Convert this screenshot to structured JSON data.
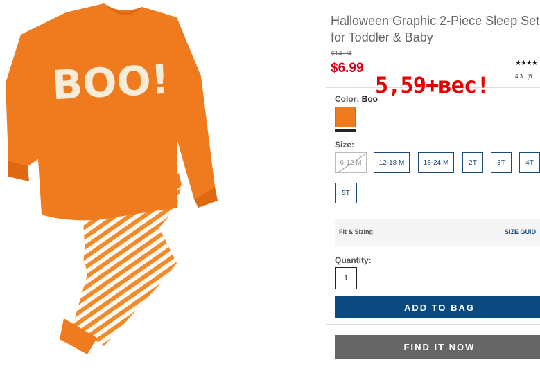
{
  "product": {
    "title": "Halloween Graphic 2-Piece Sleep Set for Toddler & Baby",
    "original_price": "$14.94",
    "sale_price": "$6.99",
    "rating_stars": "★★★★",
    "rating_score": "4.3",
    "rating_count": "(6",
    "shirt_text": "BOO!"
  },
  "overlay_note": "5,59+вес!",
  "color": {
    "label": "Color:",
    "value": "Boo",
    "swatch_color": "#f07a1e"
  },
  "size": {
    "label": "Size:",
    "options": [
      "6-12 M",
      "12-18 M",
      "18-24 M",
      "2T",
      "3T",
      "4T",
      "5T"
    ],
    "unavailable": [
      "6-12 M"
    ]
  },
  "fit": {
    "label": "Fit & Sizing",
    "guide_link": "SIZE GUID"
  },
  "quantity": {
    "label": "Quantity:",
    "value": "1"
  },
  "actions": {
    "add_to_bag": "ADD TO BAG",
    "find_it_now": "FIND IT NOW"
  },
  "colors": {
    "accent_blue": "#0b4a7e",
    "sale_red": "#d0021b",
    "overlay_red": "#e60000"
  }
}
